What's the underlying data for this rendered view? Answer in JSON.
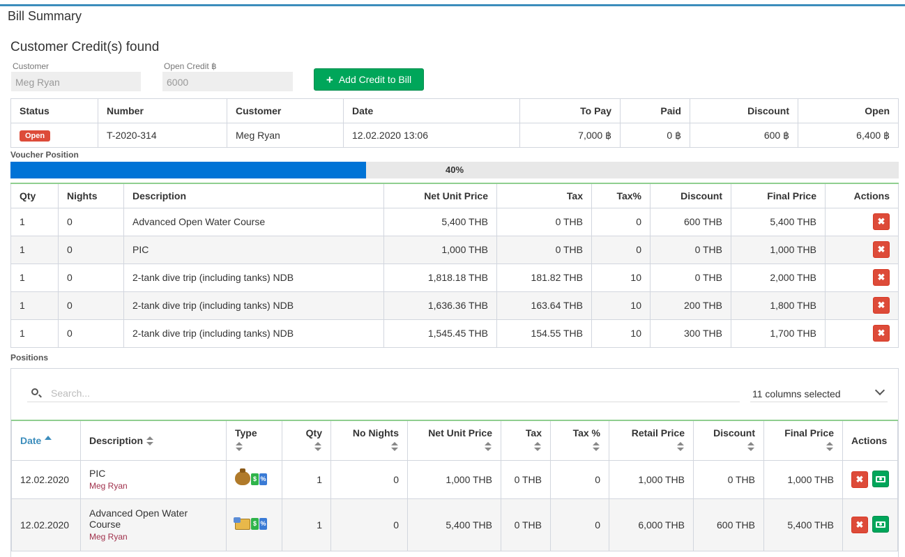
{
  "page": {
    "title": "Bill Summary"
  },
  "credits": {
    "section_title": "Customer Credit(s) found",
    "customer_label": "Customer",
    "customer_value": "Meg Ryan",
    "open_credit_label": "Open Credit ฿",
    "open_credit_value": "6000",
    "add_button_label": "Add Credit to Bill",
    "table": {
      "headers": [
        "Status",
        "Number",
        "Customer",
        "Date",
        "To Pay",
        "Paid",
        "Discount",
        "Open"
      ],
      "row": {
        "status": "Open",
        "number": "T-2020-314",
        "customer": "Meg Ryan",
        "date": "12.02.2020 13:06",
        "to_pay": "7,000 ฿",
        "paid": "0 ฿",
        "discount": "600 ฿",
        "open": "6,400 ฿"
      }
    }
  },
  "voucher": {
    "label": "Voucher Position",
    "progress_percent": 40,
    "progress_text": "40%",
    "headers": [
      "Qty",
      "Nights",
      "Description",
      "Net Unit Price",
      "Tax",
      "Tax%",
      "Discount",
      "Final Price",
      "Actions"
    ],
    "rows": [
      {
        "qty": "1",
        "nights": "0",
        "description": "Advanced Open Water Course",
        "net": "5,400 THB",
        "tax": "0 THB",
        "taxpct": "0",
        "discount": "600 THB",
        "final": "5,400 THB"
      },
      {
        "qty": "1",
        "nights": "0",
        "description": "PIC",
        "net": "1,000 THB",
        "tax": "0 THB",
        "taxpct": "0",
        "discount": "0 THB",
        "final": "1,000 THB"
      },
      {
        "qty": "1",
        "nights": "0",
        "description": "2-tank dive trip (including tanks) NDB",
        "net": "1,818.18 THB",
        "tax": "181.82 THB",
        "taxpct": "10",
        "discount": "0 THB",
        "final": "2,000 THB"
      },
      {
        "qty": "1",
        "nights": "0",
        "description": "2-tank dive trip (including tanks) NDB",
        "net": "1,636.36 THB",
        "tax": "163.64 THB",
        "taxpct": "10",
        "discount": "200 THB",
        "final": "1,800 THB"
      },
      {
        "qty": "1",
        "nights": "0",
        "description": "2-tank dive trip (including tanks) NDB",
        "net": "1,545.45 THB",
        "tax": "154.55 THB",
        "taxpct": "10",
        "discount": "300 THB",
        "final": "1,700 THB"
      }
    ]
  },
  "positions": {
    "label": "Positions",
    "search_placeholder": "Search...",
    "columns_selected": "11 columns selected",
    "headers": {
      "date": "Date",
      "description": "Description",
      "type": "Type",
      "qty": "Qty",
      "no_nights": "No Nights",
      "net_unit_price": "Net Unit Price",
      "tax": "Tax",
      "tax_pct": "Tax %",
      "retail_price": "Retail Price",
      "discount": "Discount",
      "final_price": "Final Price",
      "actions": "Actions"
    },
    "rows": [
      {
        "date": "12.02.2020",
        "description": "PIC",
        "customer": "Meg Ryan",
        "type_icons": [
          "money-bag-icon",
          "price-tag-green-icon",
          "price-tag-blue-icon"
        ],
        "qty": "1",
        "nights": "0",
        "net": "1,000 THB",
        "tax": "0 THB",
        "taxpct": "0",
        "retail": "1,000 THB",
        "discount": "0 THB",
        "final": "1,000 THB"
      },
      {
        "date": "12.02.2020",
        "description": "Advanced Open Water Course",
        "customer": "Meg Ryan",
        "type_icons": [
          "credit-card-icon",
          "price-tag-green-icon",
          "price-tag-blue-icon"
        ],
        "qty": "1",
        "nights": "0",
        "net": "5,400 THB",
        "tax": "0 THB",
        "taxpct": "0",
        "retail": "6,000 THB",
        "discount": "600 THB",
        "final": "5,400 THB"
      }
    ]
  },
  "colors": {
    "accent": "#3c8dbc",
    "success": "#00a65a",
    "danger": "#dd4b39",
    "progress": "#0073d6"
  }
}
